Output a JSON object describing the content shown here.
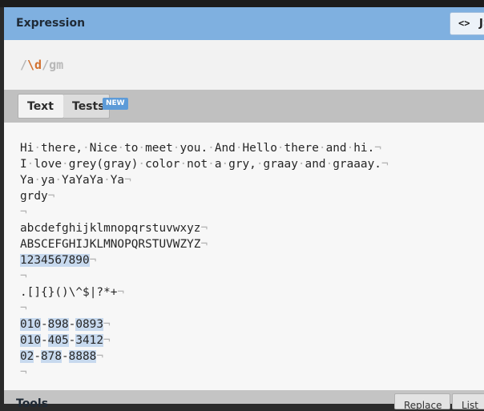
{
  "expression": {
    "title": "Expression",
    "flavor_label": "JS",
    "flavor_icon": "<>",
    "delimiter_open": "/",
    "pattern": "\\d",
    "delimiter_close": "/",
    "flags": "gm"
  },
  "tabs": {
    "text": "Text",
    "tests": "Tests",
    "new_badge": "NEW"
  },
  "eol_symbol": "¬",
  "space_symbol": "·",
  "text_lines": [
    "Hi there, Nice to meet you. And Hello there and hi.",
    "I love grey(gray) color not a gry, graay and graaay.",
    "Ya ya YaYaYa Ya",
    "grdy",
    "",
    "abcdefghijklmnopqrstuvwxyz",
    "ABSCEFGHIJKLMNOPQRSTUVWZYZ",
    "1234567890",
    "",
    ".[]{}()\\^$|?*+",
    "",
    "010-898-0893",
    "010-405-3412",
    "02-878-8888",
    ""
  ],
  "colors": {
    "header_bg": "#7fb0e0",
    "escape_token": "#d2702e",
    "match_highlight": "#c7d9ee",
    "new_badge": "#5d9bd8"
  },
  "tools": {
    "title": "Tools",
    "replace": "Replace",
    "list": "List"
  }
}
